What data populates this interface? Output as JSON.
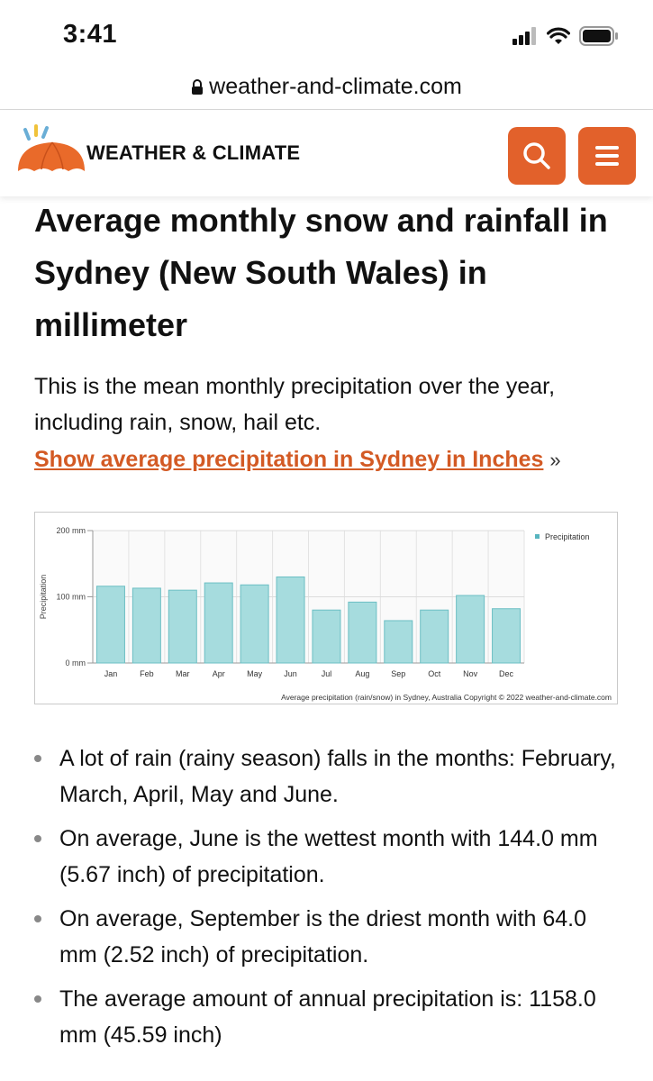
{
  "status_bar": {
    "time": "3:41"
  },
  "browser": {
    "url": "weather-and-climate.com"
  },
  "header": {
    "brand": "WEATHER & CLIMATE",
    "accent_color": "#e2612b",
    "search_icon": "search-icon",
    "menu_icon": "hamburger-icon"
  },
  "main": {
    "title": "Average monthly snow and rainfall in Sydney (New South Wales) in millimeter",
    "intro": "This is the mean monthly precipitation over the year, including rain, snow, hail etc.",
    "inch_link": "Show average precipitation in Sydney in Inches",
    "inch_link_suffix": "»"
  },
  "chart_data": {
    "type": "bar",
    "categories": [
      "Jan",
      "Feb",
      "Mar",
      "Apr",
      "May",
      "Jun",
      "Jul",
      "Aug",
      "Sep",
      "Oct",
      "Nov",
      "Dec"
    ],
    "series": [
      {
        "name": "Precipitation",
        "values": [
          116,
          113,
          110,
          121,
          118,
          130,
          80,
          92,
          64,
          80,
          102,
          82
        ]
      }
    ],
    "ylabel": "Precipitation",
    "ylim": [
      0,
      200
    ],
    "yticks": [
      "0 mm",
      "100 mm",
      "200 mm"
    ],
    "ytick_values": [
      0,
      100,
      200
    ],
    "legend": "top-right",
    "grid": true,
    "bar_color": "#a6dcde",
    "bar_stroke": "#6cbfc4",
    "caption": "Average precipitation (rain/snow) in Sydney, Australia   Copyright © 2022  weather-and-climate.com"
  },
  "facts": [
    "A lot of rain (rainy season) falls in the months: February, March, April, May and June.",
    "On average, June is the wettest month with 144.0 mm (5.67 inch) of precipitation.",
    "On average, September is the driest month with 64.0 mm (2.52 inch) of precipitation.",
    "The average amount of annual precipitation is: 1158.0 mm (45.59 inch)"
  ]
}
